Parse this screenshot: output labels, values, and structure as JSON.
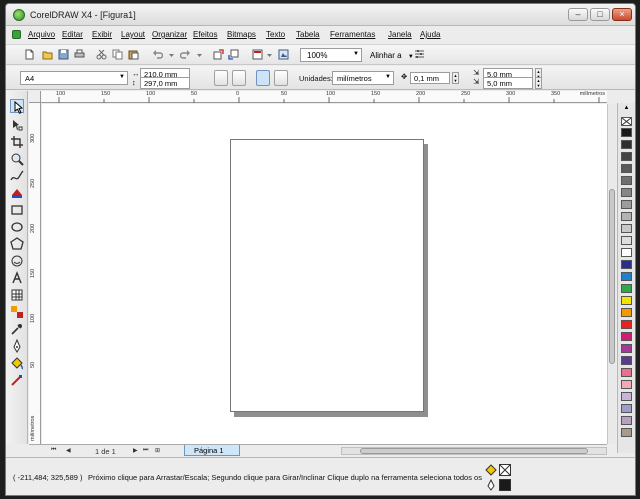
{
  "window": {
    "title": "CorelDRAW X4 - [Figura1]",
    "minimize": "–",
    "maximize": "□",
    "close": "×"
  },
  "menu": {
    "items": [
      "Arquivo",
      "Editar",
      "Exibir",
      "Layout",
      "Organizar",
      "Efeitos",
      "Bitmaps",
      "Texto",
      "Tabela",
      "Ferramentas",
      "Janela",
      "Ajuda"
    ]
  },
  "toolbar": {
    "zoom": "100%",
    "snap_label": "Alinhar a"
  },
  "property_bar": {
    "paper_size": "A4",
    "width": "210,0 mm",
    "height": "297,0 mm",
    "units_label": "Unidades:",
    "units_value": "milímetros",
    "nudge": "0,1 mm",
    "dup_x": "5,0 mm",
    "dup_y": "5,0 mm"
  },
  "ruler": {
    "h_labels": [
      "100",
      "150",
      "100",
      "50",
      "0",
      "50",
      "100",
      "150",
      "200",
      "250",
      "300",
      "350"
    ],
    "h_unit": "milímetros",
    "v_labels": [
      "300",
      "250",
      "200",
      "150",
      "100",
      "50"
    ],
    "v_unit": "milímetros"
  },
  "page_nav": {
    "count": "1 de 1",
    "tab": "Página 1"
  },
  "palette": {
    "colors": [
      "#1a1a1a",
      "#2e2e2e",
      "#444444",
      "#5a5a5a",
      "#707070",
      "#868686",
      "#9c9c9c",
      "#b2b2b2",
      "#c8c8c8",
      "#dedede",
      "#ffffff",
      "#2b2f8c",
      "#1f7fd1",
      "#2fa84a",
      "#f2e400",
      "#f29a00",
      "#e8221c",
      "#d11e74",
      "#a6379b",
      "#5c3b8f",
      "#e96f8c",
      "#f4a7b5",
      "#c8b4d8",
      "#9e9ec8",
      "#b8a0c0",
      "#a89a8a"
    ]
  },
  "status": {
    "coords": "( -211,484; 325,589 )",
    "hint": "Próximo clique para Arrastar/Escala; Segundo clique para Girar/Inclinar Clique duplo na ferramenta seleciona todos os obj..."
  }
}
